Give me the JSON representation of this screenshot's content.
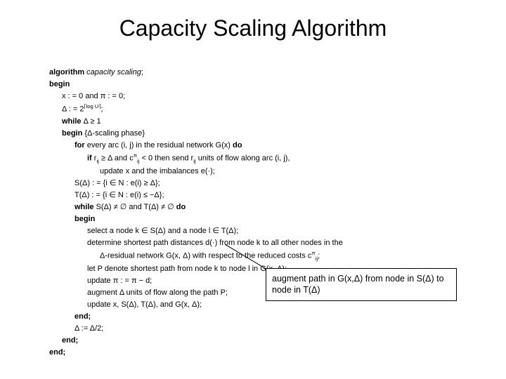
{
  "title": "Capacity Scaling Algorithm",
  "algo": {
    "l1a": "algorithm ",
    "l1b": "capacity scaling",
    "l1c": ";",
    "l2": "begin",
    "l3": "x : = 0 and π : = 0;",
    "l4_pre": "Δ : = 2",
    "l4_exp": "⌈log U⌉",
    "l4_post": ";",
    "l5a": "while ",
    "l5b": "Δ ≥ 1",
    "l6a": "begin ",
    "l6b": "{Δ-scaling phase}",
    "l7a": "for ",
    "l7b": "every arc (i, j) in the residual network G(x) ",
    "l7c": "do",
    "l8a": "if ",
    "l8b_pre": "r",
    "l8b_sub": "ij",
    "l8b_mid": " ≥ Δ and c",
    "l8b_sup": "π",
    "l8b_sub2": "ij",
    "l8b_mid2": " < 0 then send r",
    "l8b_sub3": "ij",
    "l8b_post": " units of flow along arc (i, j),",
    "l9": "update x and the imbalances e(·);",
    "l10": "S(Δ) : = {i ∈ N : e(i) ≥ Δ};",
    "l11": "T(Δ) : = {i ∈ N : e(i) ≤ −Δ};",
    "l12a": "while ",
    "l12b": "S(Δ) ≠ ∅ and  T(Δ) ≠ ∅ ",
    "l12c": "do",
    "l13": "begin",
    "l14": "select a node k ∈ S(Δ) and a node l ∈ T(Δ);",
    "l15": "determine shortest path distances d(·) from node k to all other nodes in the",
    "l16_pre": "Δ-residual network G(x, Δ) with respect to the reduced costs c",
    "l16_sup": "π",
    "l16_sub": "ij",
    "l16_post": ";",
    "l17": "let P denote shortest path from node k to node l in G(x, Δ);",
    "l18": "update π : = π − d;",
    "l19": "augment Δ units of flow along the path P;",
    "l20": "update x, S(Δ), T(Δ), and G(x, Δ);",
    "l21": "end;",
    "l22": "Δ := Δ/2;",
    "l23": "end;",
    "l24": "end;"
  },
  "callout": "augment path in G(x,Δ) from node in S(Δ) to node in T(Δ)"
}
